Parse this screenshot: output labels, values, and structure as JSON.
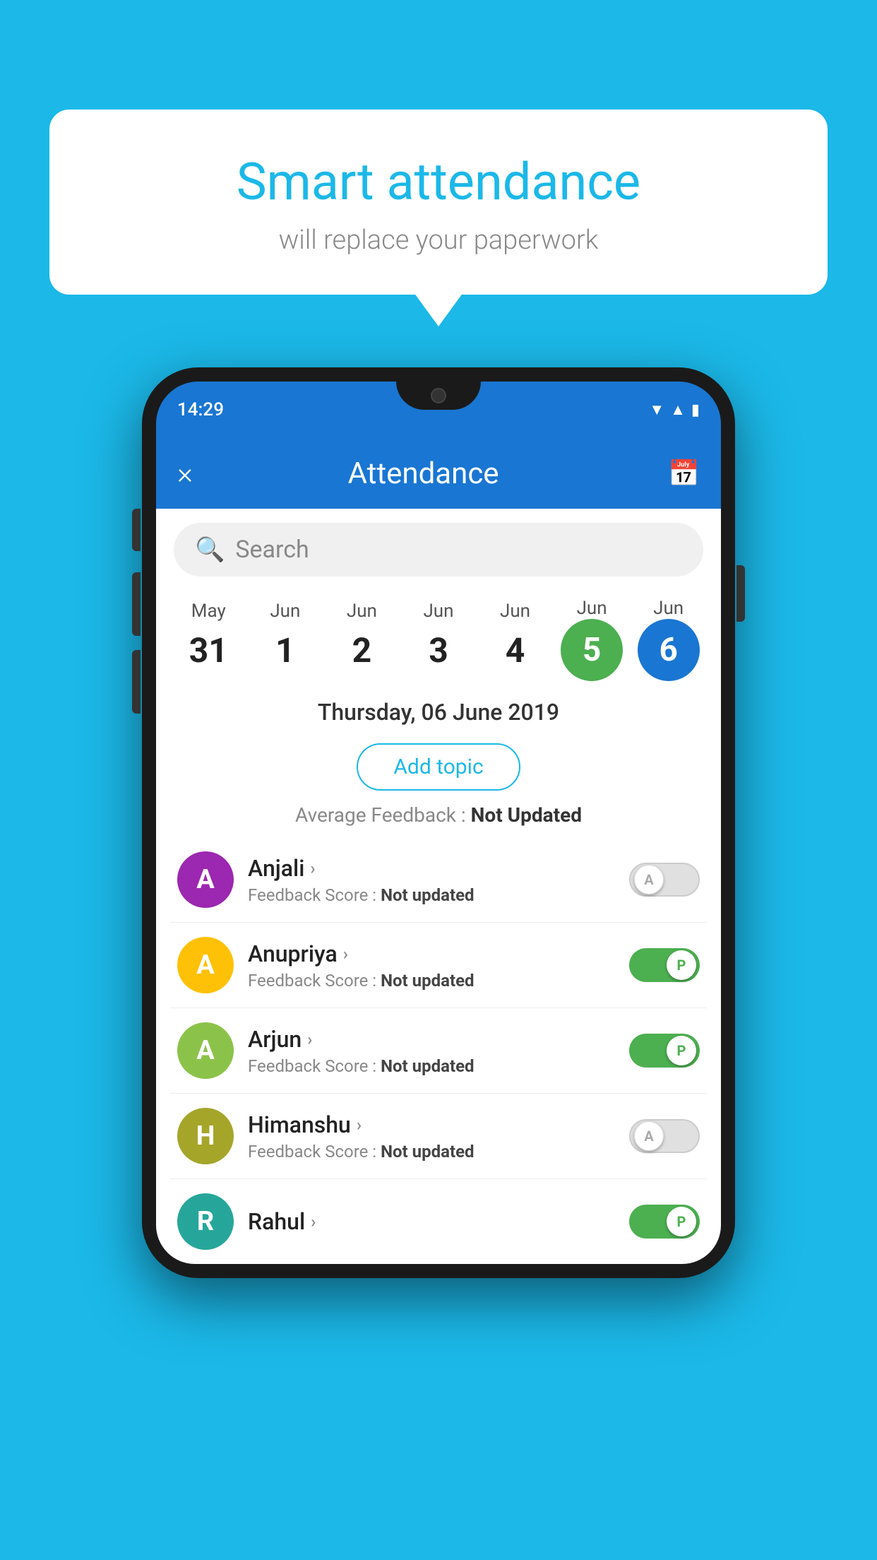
{
  "background_color": "#1BB8E8",
  "bubble": {
    "title": "Smart attendance",
    "subtitle": "will replace your paperwork"
  },
  "phone": {
    "time": "14:29",
    "app_title": "Attendance",
    "close_label": "×",
    "calendar_icon": "📅"
  },
  "search": {
    "placeholder": "Search"
  },
  "dates": [
    {
      "month": "May",
      "day": "31",
      "type": "normal"
    },
    {
      "month": "Jun",
      "day": "1",
      "type": "normal"
    },
    {
      "month": "Jun",
      "day": "2",
      "type": "normal"
    },
    {
      "month": "Jun",
      "day": "3",
      "type": "normal"
    },
    {
      "month": "Jun",
      "day": "4",
      "type": "normal"
    },
    {
      "month": "Jun",
      "day": "5",
      "type": "green"
    },
    {
      "month": "Jun",
      "day": "6",
      "type": "blue"
    }
  ],
  "selected_date": "Thursday, 06 June 2019",
  "add_topic_label": "Add topic",
  "avg_feedback_label": "Average Feedback :",
  "avg_feedback_value": "Not Updated",
  "students": [
    {
      "name": "Anjali",
      "avatar_letter": "A",
      "avatar_class": "avatar-purple",
      "feedback_label": "Feedback Score :",
      "feedback_value": "Not updated",
      "toggle": "off",
      "toggle_letter": "A"
    },
    {
      "name": "Anupriya",
      "avatar_letter": "A",
      "avatar_class": "avatar-yellow",
      "feedback_label": "Feedback Score :",
      "feedback_value": "Not updated",
      "toggle": "on",
      "toggle_letter": "P"
    },
    {
      "name": "Arjun",
      "avatar_letter": "A",
      "avatar_class": "avatar-light-green",
      "feedback_label": "Feedback Score :",
      "feedback_value": "Not updated",
      "toggle": "on",
      "toggle_letter": "P"
    },
    {
      "name": "Himanshu",
      "avatar_letter": "H",
      "avatar_class": "avatar-olive",
      "feedback_label": "Feedback Score :",
      "feedback_value": "Not updated",
      "toggle": "off",
      "toggle_letter": "A"
    }
  ]
}
